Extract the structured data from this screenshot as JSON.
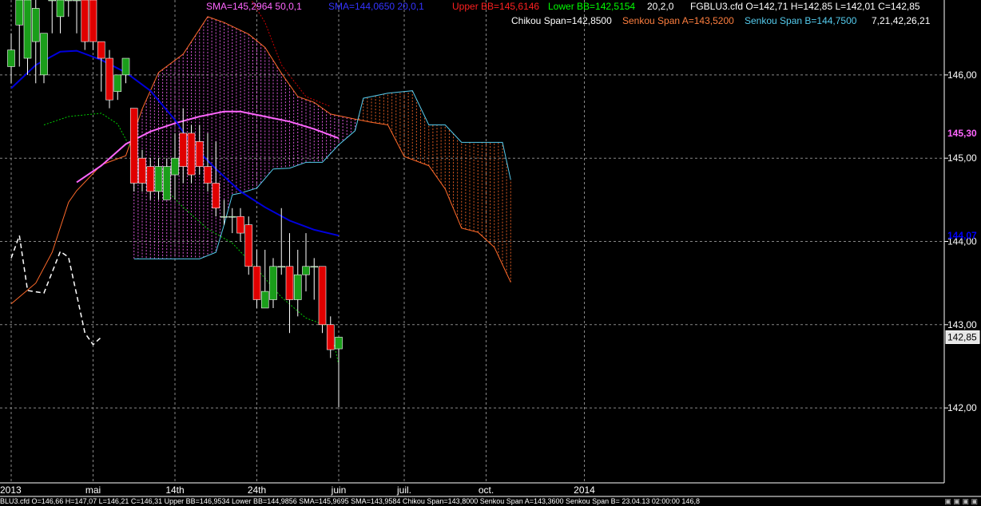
{
  "header": {
    "sma1": "SMA=145,2964  50,0,1",
    "sma2": "SMA=144,0650  20,0,1",
    "upper_bb": "Upper BB=145,6146",
    "lower_bb": "Lower BB=142,5154",
    "bb_params": "20,2,0",
    "ohlc": "FGBLU3.cfd O=142,71 H=142,85 L=142,01 C=142,85",
    "chikou": "Chikou Span=142,8500",
    "senkou_a": "Senkou Span A=143,5200",
    "senkou_b": "Senkou Span B=144,7500",
    "ichimoku_params": "7,21,42,26,21"
  },
  "status_bar": "BLU3.cfd O=146,66 H=147,07 L=146,21 C=146,31  Upper BB=146,9534 Lower BB=144,9856  SMA=145,9695 SMA=143,9584  Chikou Span=143,8000  Senkou Span A=143,3600  Senkou Span B=   23.04.13 02:00:00  146,8",
  "colors": {
    "up": "#1a9e1a",
    "down": "#e00000",
    "sma50": "#ff66ff",
    "sma20": "#0000dd",
    "senkou_a": "#ff6a2a",
    "senkou_b": "#55ccee",
    "chikou": "#ffffff",
    "lower_bb": "#00cc00",
    "upper_bb": "#cc0000",
    "grid": "#888888",
    "label_sma50": "#ff66ff",
    "label_sma20": "#3333ff",
    "label_upper": "#ff2020",
    "label_lower": "#00ff00",
    "label_senkou_a": "#ff7f3f",
    "label_senkou_b": "#55ccee"
  },
  "chart_data": {
    "type": "candlestick",
    "instrument": "FGBLU3.cfd",
    "ylim": [
      141.1,
      146.9
    ],
    "y_ticks": [
      "146,00",
      "145,00",
      "144,00",
      "143,00",
      "142,00"
    ],
    "y_tick_values": [
      146,
      145,
      144,
      143,
      142
    ],
    "x_labels": [
      "2013",
      "mai",
      "14th",
      "24th",
      "juin",
      "juil.",
      "oct.",
      "2014"
    ],
    "x_label_bars": [
      0,
      10,
      20,
      30,
      40,
      48,
      58,
      70
    ],
    "right_markers": [
      {
        "label": "145,30",
        "value": 145.3,
        "color": "#ff66ff"
      },
      {
        "label": "144,07",
        "value": 144.07,
        "color": "#0000ff"
      },
      {
        "label": "142,85",
        "value": 142.85,
        "color": "#000000"
      }
    ],
    "candles": [
      [
        146.1,
        146.3,
        145.9,
        146.5
      ],
      [
        146.6,
        146.9,
        146.1,
        146.9
      ],
      [
        146.2,
        146.9,
        146.0,
        146.9
      ],
      [
        146.4,
        146.8,
        145.9,
        146.9
      ],
      [
        146.0,
        146.5,
        145.9,
        146.5
      ],
      [
        146.9,
        146.9,
        146.5,
        146.9
      ],
      [
        146.7,
        146.9,
        146.5,
        146.9
      ],
      [
        146.9,
        146.9,
        146.7,
        146.9
      ],
      [
        146.9,
        146.9,
        146.5,
        146.9
      ],
      [
        146.9,
        146.4,
        146.3,
        146.9
      ],
      [
        146.9,
        146.4,
        146.3,
        146.9
      ],
      [
        146.4,
        146.2,
        145.8,
        146.4
      ],
      [
        146.2,
        145.7,
        145.6,
        146.3
      ],
      [
        145.8,
        146.0,
        145.7,
        146.0
      ],
      [
        146.0,
        146.2,
        145.9,
        146.2
      ],
      [
        145.6,
        144.7,
        144.6,
        145.6
      ],
      [
        145.0,
        144.7,
        144.6,
        145.1
      ],
      [
        144.9,
        144.6,
        144.5,
        145.0
      ],
      [
        144.6,
        144.9,
        144.5,
        145.0
      ],
      [
        144.5,
        144.9,
        144.5,
        145.0
      ],
      [
        144.8,
        145.0,
        144.5,
        145.3
      ],
      [
        145.3,
        144.9,
        144.7,
        145.6
      ],
      [
        145.3,
        144.8,
        144.7,
        145.4
      ],
      [
        145.2,
        144.9,
        144.8,
        145.4
      ],
      [
        144.9,
        144.7,
        144.6,
        145.3
      ],
      [
        144.7,
        144.4,
        144.3,
        145.2
      ],
      [
        144.3,
        144.3,
        144.2,
        144.5
      ],
      [
        144.3,
        144.3,
        144.1,
        144.4
      ],
      [
        144.3,
        144.1,
        144.0,
        144.4
      ],
      [
        144.2,
        143.7,
        143.6,
        144.3
      ],
      [
        143.7,
        143.3,
        143.2,
        143.9
      ],
      [
        143.2,
        143.4,
        143.2,
        143.9
      ],
      [
        143.3,
        143.7,
        143.2,
        143.8
      ],
      [
        143.7,
        143.7,
        143.6,
        144.4
      ],
      [
        143.7,
        143.3,
        142.9,
        144.1
      ],
      [
        143.3,
        143.6,
        143.1,
        143.9
      ],
      [
        143.6,
        143.7,
        143.4,
        144.1
      ],
      [
        143.7,
        143.7,
        143.3,
        143.8
      ],
      [
        143.7,
        143.0,
        142.9,
        143.7
      ],
      [
        143.0,
        142.7,
        142.6,
        143.1
      ],
      [
        142.71,
        142.85,
        142.01,
        142.85
      ]
    ],
    "sma50": [
      [
        8,
        144.71
      ],
      [
        11,
        144.91
      ],
      [
        14,
        145.17
      ],
      [
        17,
        145.32
      ],
      [
        20,
        145.42
      ],
      [
        23,
        145.5
      ],
      [
        26,
        145.56
      ],
      [
        28,
        145.56
      ],
      [
        31,
        145.5
      ],
      [
        34,
        145.44
      ],
      [
        37,
        145.35
      ],
      [
        40,
        145.24
      ]
    ],
    "sma20": [
      [
        0,
        145.84
      ],
      [
        3,
        146.12
      ],
      [
        6,
        146.28
      ],
      [
        8,
        146.29
      ],
      [
        11,
        146.18
      ],
      [
        14,
        146.03
      ],
      [
        17,
        145.81
      ],
      [
        20,
        145.46
      ],
      [
        22,
        145.17
      ],
      [
        25,
        144.87
      ],
      [
        28,
        144.6
      ],
      [
        31,
        144.41
      ],
      [
        34,
        144.25
      ],
      [
        37,
        144.14
      ],
      [
        40,
        144.07
      ]
    ],
    "senkou_a": [
      [
        0,
        143.25
      ],
      [
        3,
        143.5
      ],
      [
        5,
        143.87
      ],
      [
        7,
        144.47
      ],
      [
        8,
        144.61
      ],
      [
        11,
        144.92
      ],
      [
        14,
        145.03
      ],
      [
        16,
        145.59
      ],
      [
        18,
        146.03
      ],
      [
        21,
        146.25
      ],
      [
        24,
        146.7
      ],
      [
        26,
        146.63
      ],
      [
        29,
        146.49
      ],
      [
        31,
        146.33
      ],
      [
        33,
        146.02
      ],
      [
        35,
        145.74
      ],
      [
        37,
        145.67
      ],
      [
        39,
        145.53
      ],
      [
        42,
        145.47
      ],
      [
        44,
        145.43
      ],
      [
        46,
        145.4
      ],
      [
        48,
        145.02
      ],
      [
        51,
        144.91
      ],
      [
        53,
        144.63
      ],
      [
        55,
        144.16
      ],
      [
        57,
        144.11
      ],
      [
        59,
        143.93
      ],
      [
        61,
        143.51
      ]
    ],
    "senkou_b": [
      [
        15,
        143.79
      ],
      [
        18,
        143.79
      ],
      [
        22,
        143.79
      ],
      [
        23,
        143.79
      ],
      [
        25,
        143.87
      ],
      [
        26,
        144.2
      ],
      [
        27,
        144.56
      ],
      [
        28,
        144.58
      ],
      [
        30,
        144.64
      ],
      [
        32,
        144.87
      ],
      [
        34,
        144.88
      ],
      [
        36,
        144.95
      ],
      [
        38,
        144.95
      ],
      [
        40,
        145.16
      ],
      [
        42,
        145.33
      ],
      [
        43,
        145.72
      ],
      [
        46,
        145.78
      ],
      [
        49,
        145.81
      ],
      [
        51,
        145.4
      ],
      [
        53,
        145.4
      ],
      [
        55,
        145.19
      ],
      [
        57,
        145.19
      ],
      [
        60,
        145.19
      ],
      [
        61,
        144.74
      ]
    ],
    "chikou": [
      [
        0,
        143.8
      ],
      [
        1,
        144.07
      ],
      [
        2,
        143.41
      ],
      [
        4,
        143.38
      ],
      [
        6,
        143.88
      ],
      [
        7,
        143.81
      ],
      [
        8,
        143.36
      ],
      [
        9,
        142.9
      ],
      [
        10,
        142.76
      ],
      [
        11,
        142.85
      ]
    ],
    "lower_bb": [
      [
        4,
        145.4
      ],
      [
        7,
        145.5
      ],
      [
        11,
        145.54
      ],
      [
        13,
        145.41
      ],
      [
        15,
        145.04
      ],
      [
        18,
        144.71
      ],
      [
        21,
        144.41
      ],
      [
        24,
        144.15
      ],
      [
        27,
        143.98
      ],
      [
        30,
        143.67
      ],
      [
        33,
        143.33
      ],
      [
        36,
        143.08
      ],
      [
        39,
        142.97
      ],
      [
        40,
        142.52
      ]
    ],
    "upper_bb": [
      [
        29,
        146.95
      ],
      [
        31,
        146.63
      ],
      [
        33,
        146.12
      ],
      [
        36,
        145.74
      ],
      [
        39,
        145.62
      ]
    ]
  }
}
